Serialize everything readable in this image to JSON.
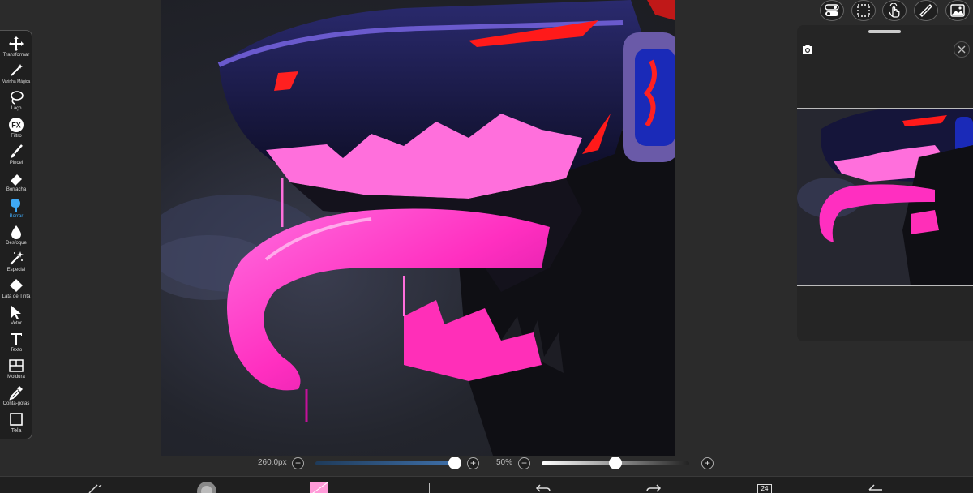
{
  "toolbar": {
    "tools": [
      {
        "label": "Transformar",
        "icon": "move-icon"
      },
      {
        "label": "Varinha Mágica",
        "icon": "magic-wand-icon"
      },
      {
        "label": "Laço",
        "icon": "lasso-icon"
      },
      {
        "label": "Filtro",
        "icon": "fx-icon"
      },
      {
        "label": "Pincel",
        "icon": "brush-icon"
      },
      {
        "label": "Borracha",
        "icon": "eraser-icon"
      },
      {
        "label": "Borrar",
        "icon": "smudge-icon",
        "active": true
      },
      {
        "label": "Desfoque",
        "icon": "blur-drop-icon"
      },
      {
        "label": "Especial",
        "icon": "sparkle-wand-icon"
      },
      {
        "label": "Lata de Tinta",
        "icon": "paint-bucket-icon"
      },
      {
        "label": "Vetor",
        "icon": "cursor-arrow-icon"
      },
      {
        "label": "Texto",
        "icon": "text-t-icon"
      },
      {
        "label": "Moldura",
        "icon": "frame-divider-icon"
      },
      {
        "label": "Conta-gotas",
        "icon": "eyedropper-icon"
      },
      {
        "label": "Tela",
        "icon": "canvas-square-icon"
      }
    ]
  },
  "topbar": {
    "buttons": [
      "toggle-icon",
      "selection-icon",
      "touch-hand-icon",
      "ruler-icon",
      "image-icon"
    ]
  },
  "navigator": {
    "camera_icon": "camera-icon",
    "close_icon": "close-icon"
  },
  "sliders": {
    "size_value": "260.0px",
    "size_fraction": 1.0,
    "opacity_value": "50%",
    "opacity_fraction": 0.5
  },
  "bottombar": {
    "icons": [
      "brush-settings-icon",
      "brush-tip-icon",
      "color-swatch-icon",
      "divider",
      "undo-icon",
      "redo-icon",
      "layers-icon",
      "back-icon"
    ],
    "layers_count": "24"
  },
  "colors": {
    "accent": "#3fa9f5",
    "panel": "#1f1f1f",
    "pink": "#ff3fc9",
    "red_eye": "#ff1a1a"
  }
}
